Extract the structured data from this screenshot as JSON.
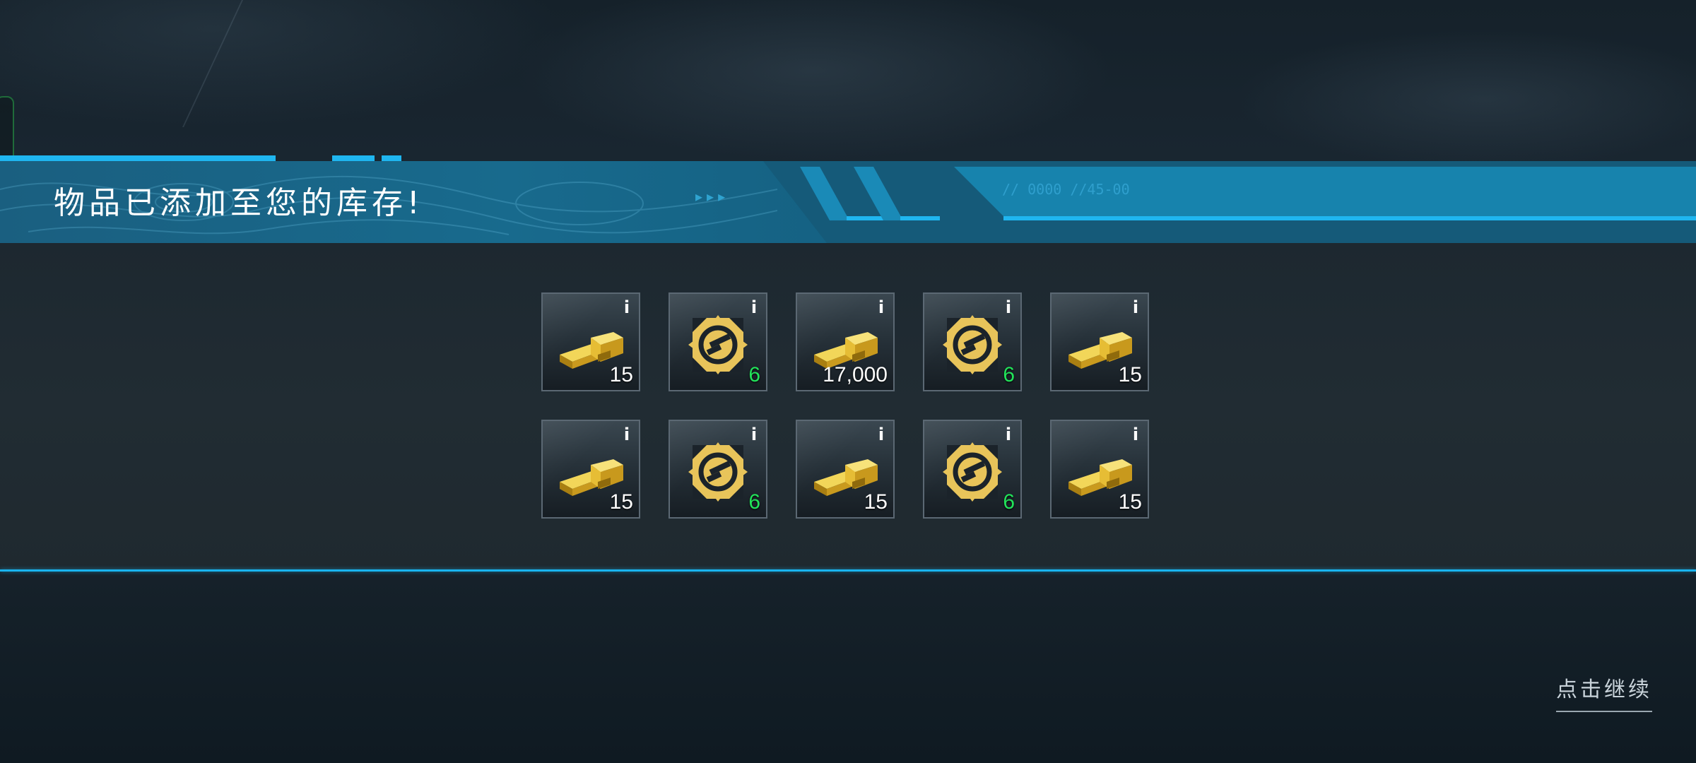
{
  "banner": {
    "title": "物品已添加至您的库存!",
    "arrows": "▸▸▸",
    "code": "// 0000 //45-00"
  },
  "items": [
    {
      "type": "gold-bars",
      "quantity": "15",
      "qty_color": "white"
    },
    {
      "type": "upgrade-kit",
      "quantity": "6",
      "qty_color": "green"
    },
    {
      "type": "gold-bars",
      "quantity": "17,000",
      "qty_color": "white"
    },
    {
      "type": "upgrade-kit",
      "quantity": "6",
      "qty_color": "green"
    },
    {
      "type": "gold-bars",
      "quantity": "15",
      "qty_color": "white"
    },
    {
      "type": "gold-bars",
      "quantity": "15",
      "qty_color": "white"
    },
    {
      "type": "upgrade-kit",
      "quantity": "6",
      "qty_color": "green"
    },
    {
      "type": "gold-bars",
      "quantity": "15",
      "qty_color": "white"
    },
    {
      "type": "upgrade-kit",
      "quantity": "6",
      "qty_color": "green"
    },
    {
      "type": "gold-bars",
      "quantity": "15",
      "qty_color": "white"
    }
  ],
  "info_label": "i",
  "continue_label": "点击继续",
  "colors": {
    "accent": "#1fb6f0",
    "quantity_green": "#22e35a",
    "gold": "#d9b23a"
  }
}
